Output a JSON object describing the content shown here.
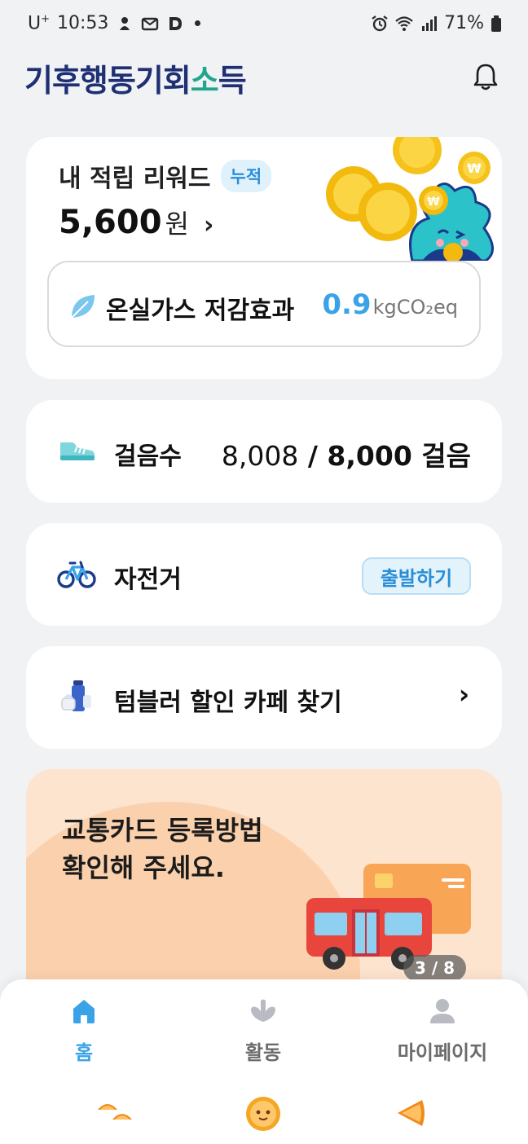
{
  "status_bar": {
    "carrier": "U",
    "carrier_sup": "+",
    "time": "10:53",
    "battery": "71%"
  },
  "header": {
    "logo_text_1": "기후행동기회",
    "logo_text_2": "소",
    "logo_text_3": "득"
  },
  "reward": {
    "title": "내 적립 리워드",
    "badge": "누적",
    "amount": "5,600",
    "unit": "원",
    "chevron": "›"
  },
  "ghg": {
    "label": "온실가스 저감효과",
    "value": "0.9",
    "unit": "kgCO₂eq"
  },
  "steps": {
    "label": "걸음수",
    "current": "8,008",
    "separator": " / ",
    "goal": "8,000 걸음"
  },
  "bike": {
    "label": "자전거",
    "button": "출발하기"
  },
  "tumbler": {
    "label": "텀블러 할인 카페 찾기",
    "chevron": "›"
  },
  "banner": {
    "line1": "교통카드 등록방법",
    "line2": "확인해 주세요.",
    "page": "3 / 8"
  },
  "nav": {
    "home": "홈",
    "activity": "활동",
    "mypage": "마이페이지"
  },
  "colors": {
    "accent": "#3aa3e8",
    "brand": "#1f2f74",
    "brand_green": "#22a58d",
    "background": "#f1f2f4",
    "banner": "#fde4cf"
  },
  "icons": [
    "bell-icon",
    "leaf-icon",
    "shoe-icon",
    "bicycle-icon",
    "tumbler-icon",
    "home-icon",
    "activity-icon",
    "user-icon"
  ]
}
